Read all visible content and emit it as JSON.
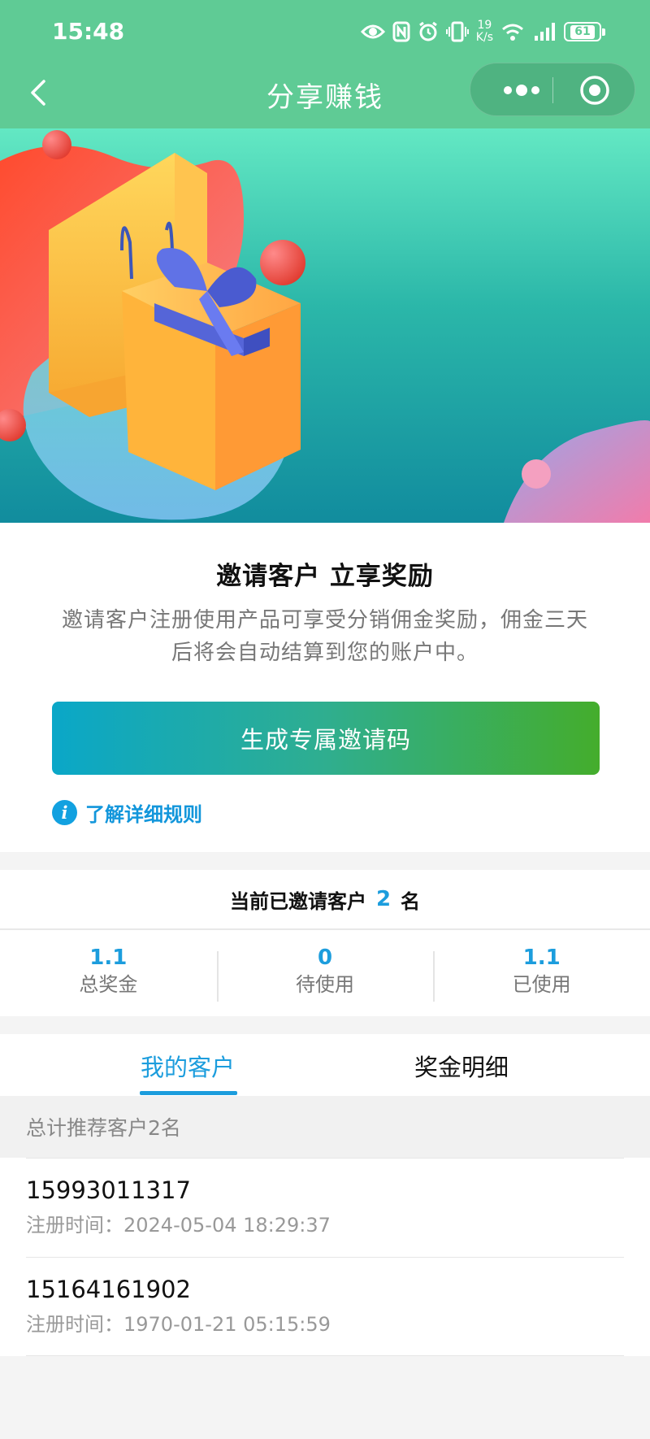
{
  "status_bar": {
    "time": "15:48",
    "net_speed_value": "19",
    "net_speed_unit": "K/s",
    "battery": "61",
    "icons": [
      "eye-icon",
      "nfc-icon",
      "alarm-icon",
      "vibrate-icon",
      "wifi-icon",
      "signal-icon",
      "battery-icon"
    ]
  },
  "navbar": {
    "title": "分享赚钱",
    "back_icon": "chevron-left-icon",
    "more_icon": "more-dots-icon",
    "target_icon": "target-icon"
  },
  "invite": {
    "title": "邀请客户 立享奖励",
    "description": "邀请客户注册使用产品可享受分销佣金奖励，佣金三天后将会自动结算到您的账户中。",
    "button_label": "生成专属邀请码",
    "rules_link": "了解详细规则",
    "rules_icon": "info-icon"
  },
  "stats": {
    "invited_prefix": "当前已邀请客户",
    "invited_count": "2",
    "invited_suffix": "名",
    "items": [
      {
        "value": "1.1",
        "label": "总奖金"
      },
      {
        "value": "0",
        "label": "待使用"
      },
      {
        "value": "1.1",
        "label": "已使用"
      }
    ]
  },
  "tabs": [
    {
      "label": "我的客户",
      "active": true
    },
    {
      "label": "奖金明细",
      "active": false
    }
  ],
  "customers": {
    "summary": "总计推荐客户2名",
    "time_label": "注册时间：",
    "items": [
      {
        "phone": "15993011317",
        "registered": "2024-05-04 18:29:37"
      },
      {
        "phone": "15164161902",
        "registered": "1970-01-21 05:15:59"
      }
    ]
  },
  "colors": {
    "header_green": "#5fcb95",
    "accent_blue": "#1c9ddd",
    "button_gradient_start": "#0aa7c8",
    "button_gradient_end": "#44ad2c"
  }
}
